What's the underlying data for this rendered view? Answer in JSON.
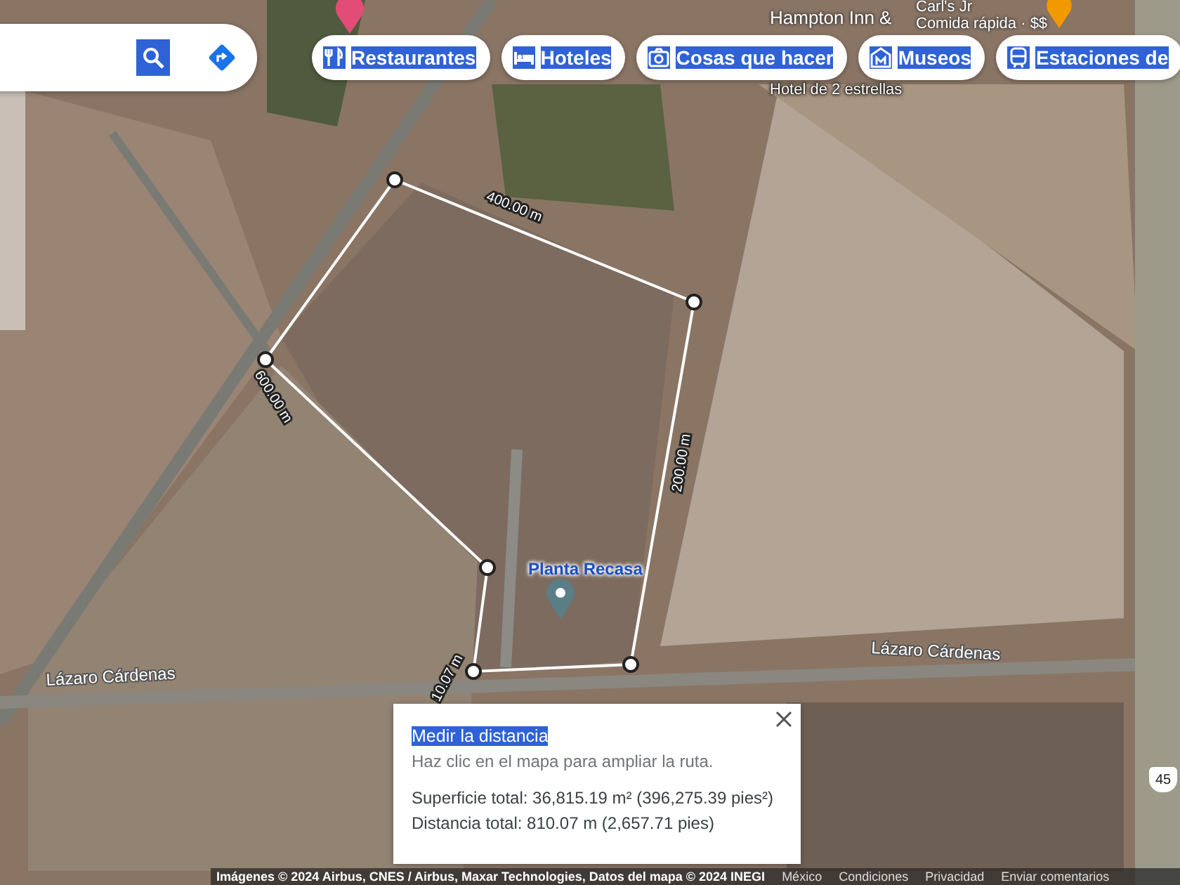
{
  "search_bar": {
    "buttons": [
      {
        "kind": "search"
      },
      {
        "kind": "directions"
      }
    ]
  },
  "category_chips": [
    {
      "kind": "restaurant",
      "label": "Restaurantes",
      "highlighted": true
    },
    {
      "kind": "hotel",
      "label": "Hoteles",
      "highlighted": true
    },
    {
      "kind": "camera",
      "label": "Cosas que hacer",
      "highlighted": true
    },
    {
      "kind": "museum",
      "label": "Museos",
      "highlighted": true
    },
    {
      "kind": "train",
      "label": "Estaciones de",
      "highlighted": true
    }
  ],
  "map": {
    "place_labels": [
      {
        "kind": "hotel",
        "lines": [
          "Hampton Inn &",
          "Hotel de 2 estrellas"
        ]
      },
      {
        "kind": "food",
        "lines": [
          "Carl's Jr",
          "Comida rápida · $$"
        ]
      },
      {
        "kind": "place",
        "lines": [
          "Planta Recasa"
        ]
      }
    ],
    "road_labels": [
      "Lázaro Cárdenas",
      "Lázaro Cárdenas"
    ],
    "highway_shield": "45",
    "segment_labels": [
      "400.00 m",
      "200.00 m",
      "10.07 m",
      "600.00 m"
    ]
  },
  "measure_panel": {
    "title": "Medir la distancia",
    "title_highlighted": true,
    "hint": "Haz clic en el mapa para ampliar la ruta.",
    "area": "Superficie total: 36,815.19 m² (396,275.39 pies²)",
    "distance": "Distancia total: 810.07 m (2,657.71 pies)"
  },
  "attribution": {
    "credits": "Imágenes © 2024 Airbus, CNES / Airbus, Maxar Technologies, Datos del mapa © 2024 INEGI",
    "links": [
      "México",
      "Condiciones",
      "Privacidad",
      "Enviar comentarios"
    ]
  }
}
